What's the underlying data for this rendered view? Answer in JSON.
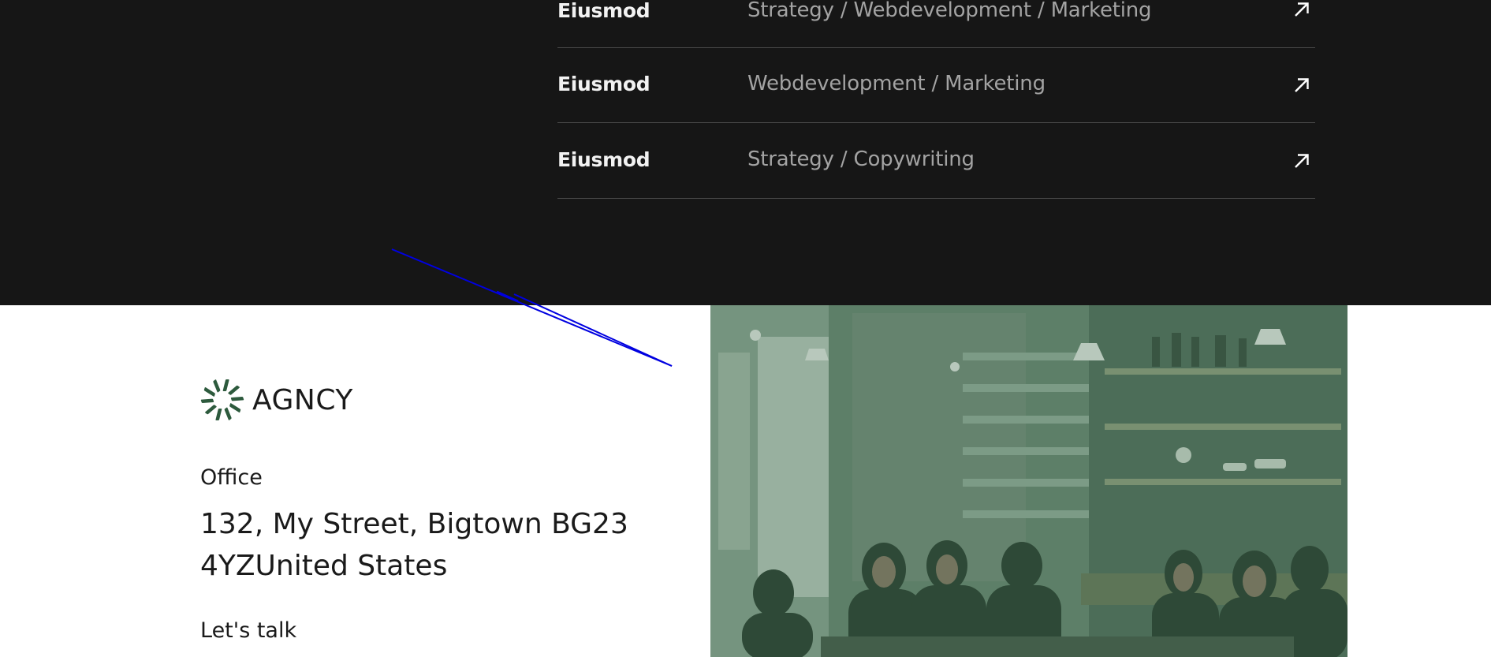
{
  "projects": {
    "rows": [
      {
        "name": "Eiusmod",
        "categories": "Strategy / Webdevelopment / Marketing",
        "arrow_icon": "arrow-up-right-icon"
      },
      {
        "name": "Eiusmod",
        "categories": "Webdevelopment / Marketing",
        "arrow_icon": "arrow-up-right-icon"
      },
      {
        "name": "Eiusmod",
        "categories": "Strategy / Copywriting",
        "arrow_icon": "arrow-up-right-icon"
      }
    ]
  },
  "footer": {
    "logo_text": "AGNCY",
    "office_label": "Office",
    "address": "132, My Street, Bigtown BG23 4YZUnited States",
    "talk_label": "Let's talk"
  },
  "colors": {
    "dark_bg": "#161616",
    "row_name": "#f2f2f2",
    "row_category": "#a3a3a3",
    "divider": "#4a4a4a",
    "logo_green": "#2d5a3d",
    "photo_tint": "#5f7f6a",
    "annotation": "#0000e0"
  }
}
